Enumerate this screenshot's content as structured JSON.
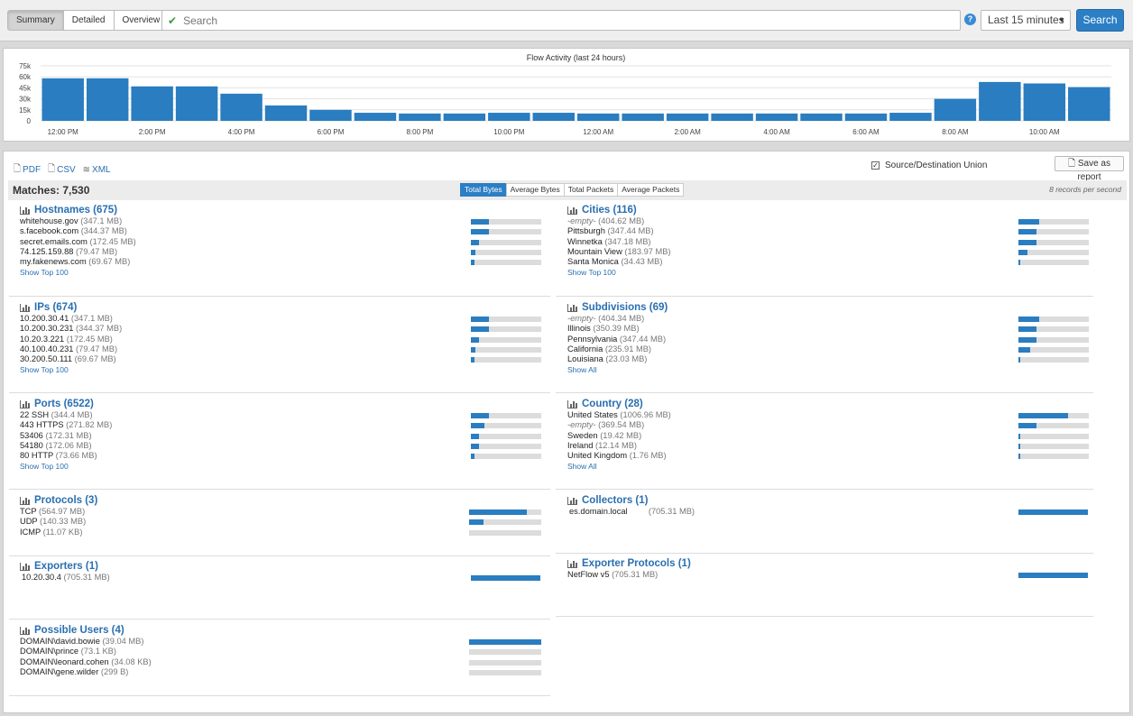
{
  "viewtabs": [
    "Summary",
    "Detailed",
    "Overview"
  ],
  "search": {
    "placeholder": "Search",
    "button": "Search",
    "time_range": "Last 15 minutes"
  },
  "chart": {
    "title": "Flow Activity (last 24 hours)"
  },
  "chart_data": {
    "type": "bar",
    "title": "Flow Activity (last 24 hours)",
    "y_ticks": [
      "75k",
      "60k",
      "45k",
      "30k",
      "15k",
      "0"
    ],
    "ylim": [
      0,
      75000
    ],
    "x_tick_labels": [
      "12:00 PM",
      "2:00 PM",
      "4:00 PM",
      "6:00 PM",
      "8:00 PM",
      "10:00 PM",
      "12:00 AM",
      "2:00 AM",
      "4:00 AM",
      "6:00 AM",
      "8:00 AM",
      "10:00 AM"
    ],
    "values": [
      58000,
      58000,
      47000,
      47000,
      37000,
      21000,
      15000,
      11000,
      10000,
      10000,
      11000,
      11000,
      10000,
      10000,
      10000,
      10000,
      10000,
      10000,
      10000,
      11000,
      30000,
      53000,
      51000,
      46000
    ],
    "grid": true,
    "color": "#2a7dc0"
  },
  "toolbar": {
    "pdf": "PDF",
    "csv": "CSV",
    "xml": "XML",
    "union_label": "Source/Destination Union",
    "save_report": "Save as report"
  },
  "matches": "Matches: 7,530",
  "metric_tabs": [
    "Total Bytes",
    "Average Bytes",
    "Total Packets",
    "Average Packets"
  ],
  "records_per_second": "8 records per second",
  "sections": {
    "hostnames": {
      "title": "Hostnames (675)",
      "link": "Show Top 100",
      "rows": [
        {
          "name": "whitehouse.gov",
          "value": "(347.1 MB)",
          "frac": 0.25
        },
        {
          "name": "s.facebook.com",
          "value": "(344.37 MB)",
          "frac": 0.25
        },
        {
          "name": "secret.emails.com",
          "value": "(172.45 MB)",
          "frac": 0.12
        },
        {
          "name": "74.125.159.88",
          "value": "(79.47 MB)",
          "frac": 0.06
        },
        {
          "name": "my.fakenews.com",
          "value": "(69.67 MB)",
          "frac": 0.05
        }
      ]
    },
    "cities": {
      "title": "Cities (116)",
      "link": "Show Top 100",
      "rows": [
        {
          "name": "-empty-",
          "value": "(404.62 MB)",
          "frac": 0.29
        },
        {
          "name": "Pittsburgh",
          "value": "(347.44 MB)",
          "frac": 0.25
        },
        {
          "name": "Winnetka",
          "value": "(347.18 MB)",
          "frac": 0.25
        },
        {
          "name": "Mountain View",
          "value": "(183.97 MB)",
          "frac": 0.13
        },
        {
          "name": "Santa Monica",
          "value": "(34.43 MB)",
          "frac": 0.025
        }
      ]
    },
    "ips": {
      "title": "IPs (674)",
      "link": "Show Top 100",
      "rows": [
        {
          "name": "10.200.30.41",
          "value": "(347.1 MB)",
          "frac": 0.25
        },
        {
          "name": "10.200.30.231",
          "value": "(344.37 MB)",
          "frac": 0.25
        },
        {
          "name": "10.20.3.221",
          "value": "(172.45 MB)",
          "frac": 0.12
        },
        {
          "name": "40.100.40.231",
          "value": "(79.47 MB)",
          "frac": 0.06
        },
        {
          "name": "30.200.50.111",
          "value": "(69.67 MB)",
          "frac": 0.05
        }
      ]
    },
    "subdivisions": {
      "title": "Subdivisions (69)",
      "link": "Show All",
      "rows": [
        {
          "name": "-empty-",
          "value": "(404.34 MB)",
          "frac": 0.29
        },
        {
          "name": "Illinois",
          "value": "(350.39 MB)",
          "frac": 0.25
        },
        {
          "name": "Pennsylvania",
          "value": "(347.44 MB)",
          "frac": 0.25
        },
        {
          "name": "California",
          "value": "(235.91 MB)",
          "frac": 0.17
        },
        {
          "name": "Louisiana",
          "value": "(23.03 MB)",
          "frac": 0.02
        }
      ]
    },
    "ports": {
      "title": "Ports (6522)",
      "link": "Show Top 100",
      "rows": [
        {
          "name": "22 SSH",
          "value": "(344.4 MB)",
          "frac": 0.25
        },
        {
          "name": "443 HTTPS",
          "value": "(271.82 MB)",
          "frac": 0.19
        },
        {
          "name": "53406",
          "value": "(172.31 MB)",
          "frac": 0.12
        },
        {
          "name": "54180",
          "value": "(172.06 MB)",
          "frac": 0.12
        },
        {
          "name": "80 HTTP",
          "value": "(73.66 MB)",
          "frac": 0.05
        }
      ]
    },
    "country": {
      "title": "Country (28)",
      "link": "Show All",
      "rows": [
        {
          "name": "United States",
          "value": "(1006.96 MB)",
          "frac": 0.71
        },
        {
          "name": "-empty-",
          "value": "(369.54 MB)",
          "frac": 0.26
        },
        {
          "name": "Sweden",
          "value": "(19.42 MB)",
          "frac": 0.015
        },
        {
          "name": "Ireland",
          "value": "(12.14 MB)",
          "frac": 0.01
        },
        {
          "name": "United Kingdom",
          "value": "(1.76 MB)",
          "frac": 0.005
        }
      ]
    },
    "protocols": {
      "title": "Protocols (3)",
      "rows": [
        {
          "name": "TCP",
          "value": "(564.97 MB)",
          "frac": 0.8
        },
        {
          "name": "UDP",
          "value": "(140.33 MB)",
          "frac": 0.2
        },
        {
          "name": "ICMP",
          "value": "(11.07 KB)",
          "frac": 0.0
        }
      ]
    },
    "collectors": {
      "title": "Collectors (1)",
      "rows": [
        {
          "name": "es.domain.local",
          "value": "(705.31 MB)",
          "frac": 1.0
        }
      ]
    },
    "exporters": {
      "title": "Exporters (1)",
      "rows": [
        {
          "name": "10.20.30.4",
          "value": "(705.31 MB)",
          "frac": 1.0
        }
      ]
    },
    "exporter_protocols": {
      "title": "Exporter Protocols (1)",
      "rows": [
        {
          "name": "NetFlow v5",
          "value": "(705.31 MB)",
          "frac": 1.0
        }
      ]
    },
    "users": {
      "title": "Possible Users (4)",
      "rows": [
        {
          "name": "DOMAIN\\david.bowie",
          "value": "(39.04 MB)",
          "frac": 1.0
        },
        {
          "name": "DOMAIN\\prince",
          "value": "(73.1 KB)",
          "frac": 0.0
        },
        {
          "name": "DOMAIN\\leonard.cohen",
          "value": "(34.08 KB)",
          "frac": 0.0
        },
        {
          "name": "DOMAIN\\gene.wilder",
          "value": "(299 B)",
          "frac": 0.0
        }
      ]
    }
  }
}
